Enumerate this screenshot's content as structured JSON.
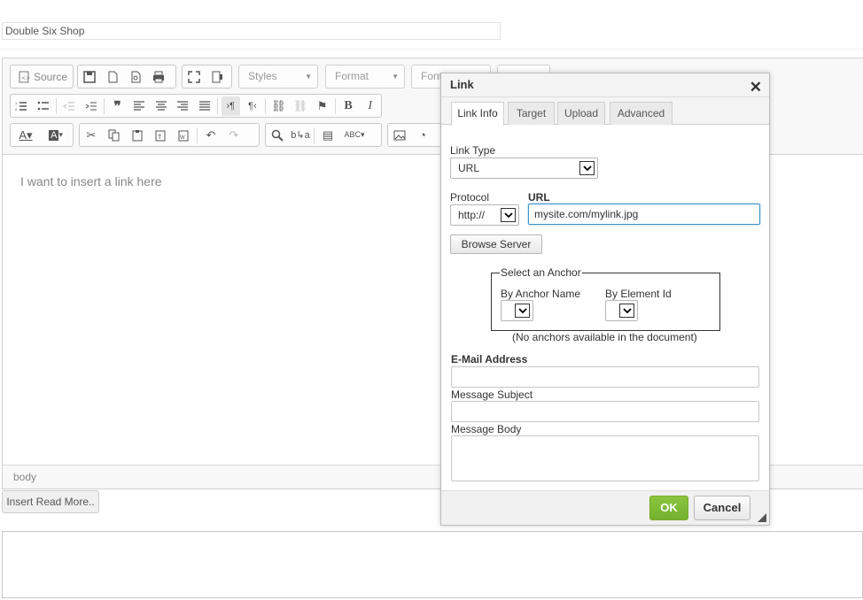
{
  "page": {
    "title_field_value": "Double Six Shop"
  },
  "toolbar": {
    "source_label": "Source",
    "styles_label": "Styles",
    "format_label": "Format",
    "font_label": "Font",
    "size_label": ""
  },
  "editor": {
    "content_text": "I want to insert a link here",
    "status_path": "body"
  },
  "actions": {
    "read_more_label": "Insert Read More.."
  },
  "dialog": {
    "title": "Link",
    "tabs": [
      "Link Info",
      "Target",
      "Upload",
      "Advanced"
    ],
    "link_type_label": "Link Type",
    "link_type_value": "URL",
    "protocol_label": "Protocol",
    "protocol_value": "http://",
    "url_label": "URL",
    "url_value": "mysite.com/mylink.jpg",
    "browse_server_label": "Browse Server",
    "anchor_legend": "Select an Anchor",
    "by_anchor_name_label": "By Anchor Name",
    "by_element_id_label": "By Element Id",
    "no_anchors_text": "(No anchors available in the document)",
    "email_label": "E-Mail Address",
    "message_subject_label": "Message Subject",
    "message_body_label": "Message Body",
    "ok_label": "OK",
    "cancel_label": "Cancel"
  },
  "colors": {
    "ok_button": "#7bbf33",
    "focus_border": "#3f95c6"
  }
}
